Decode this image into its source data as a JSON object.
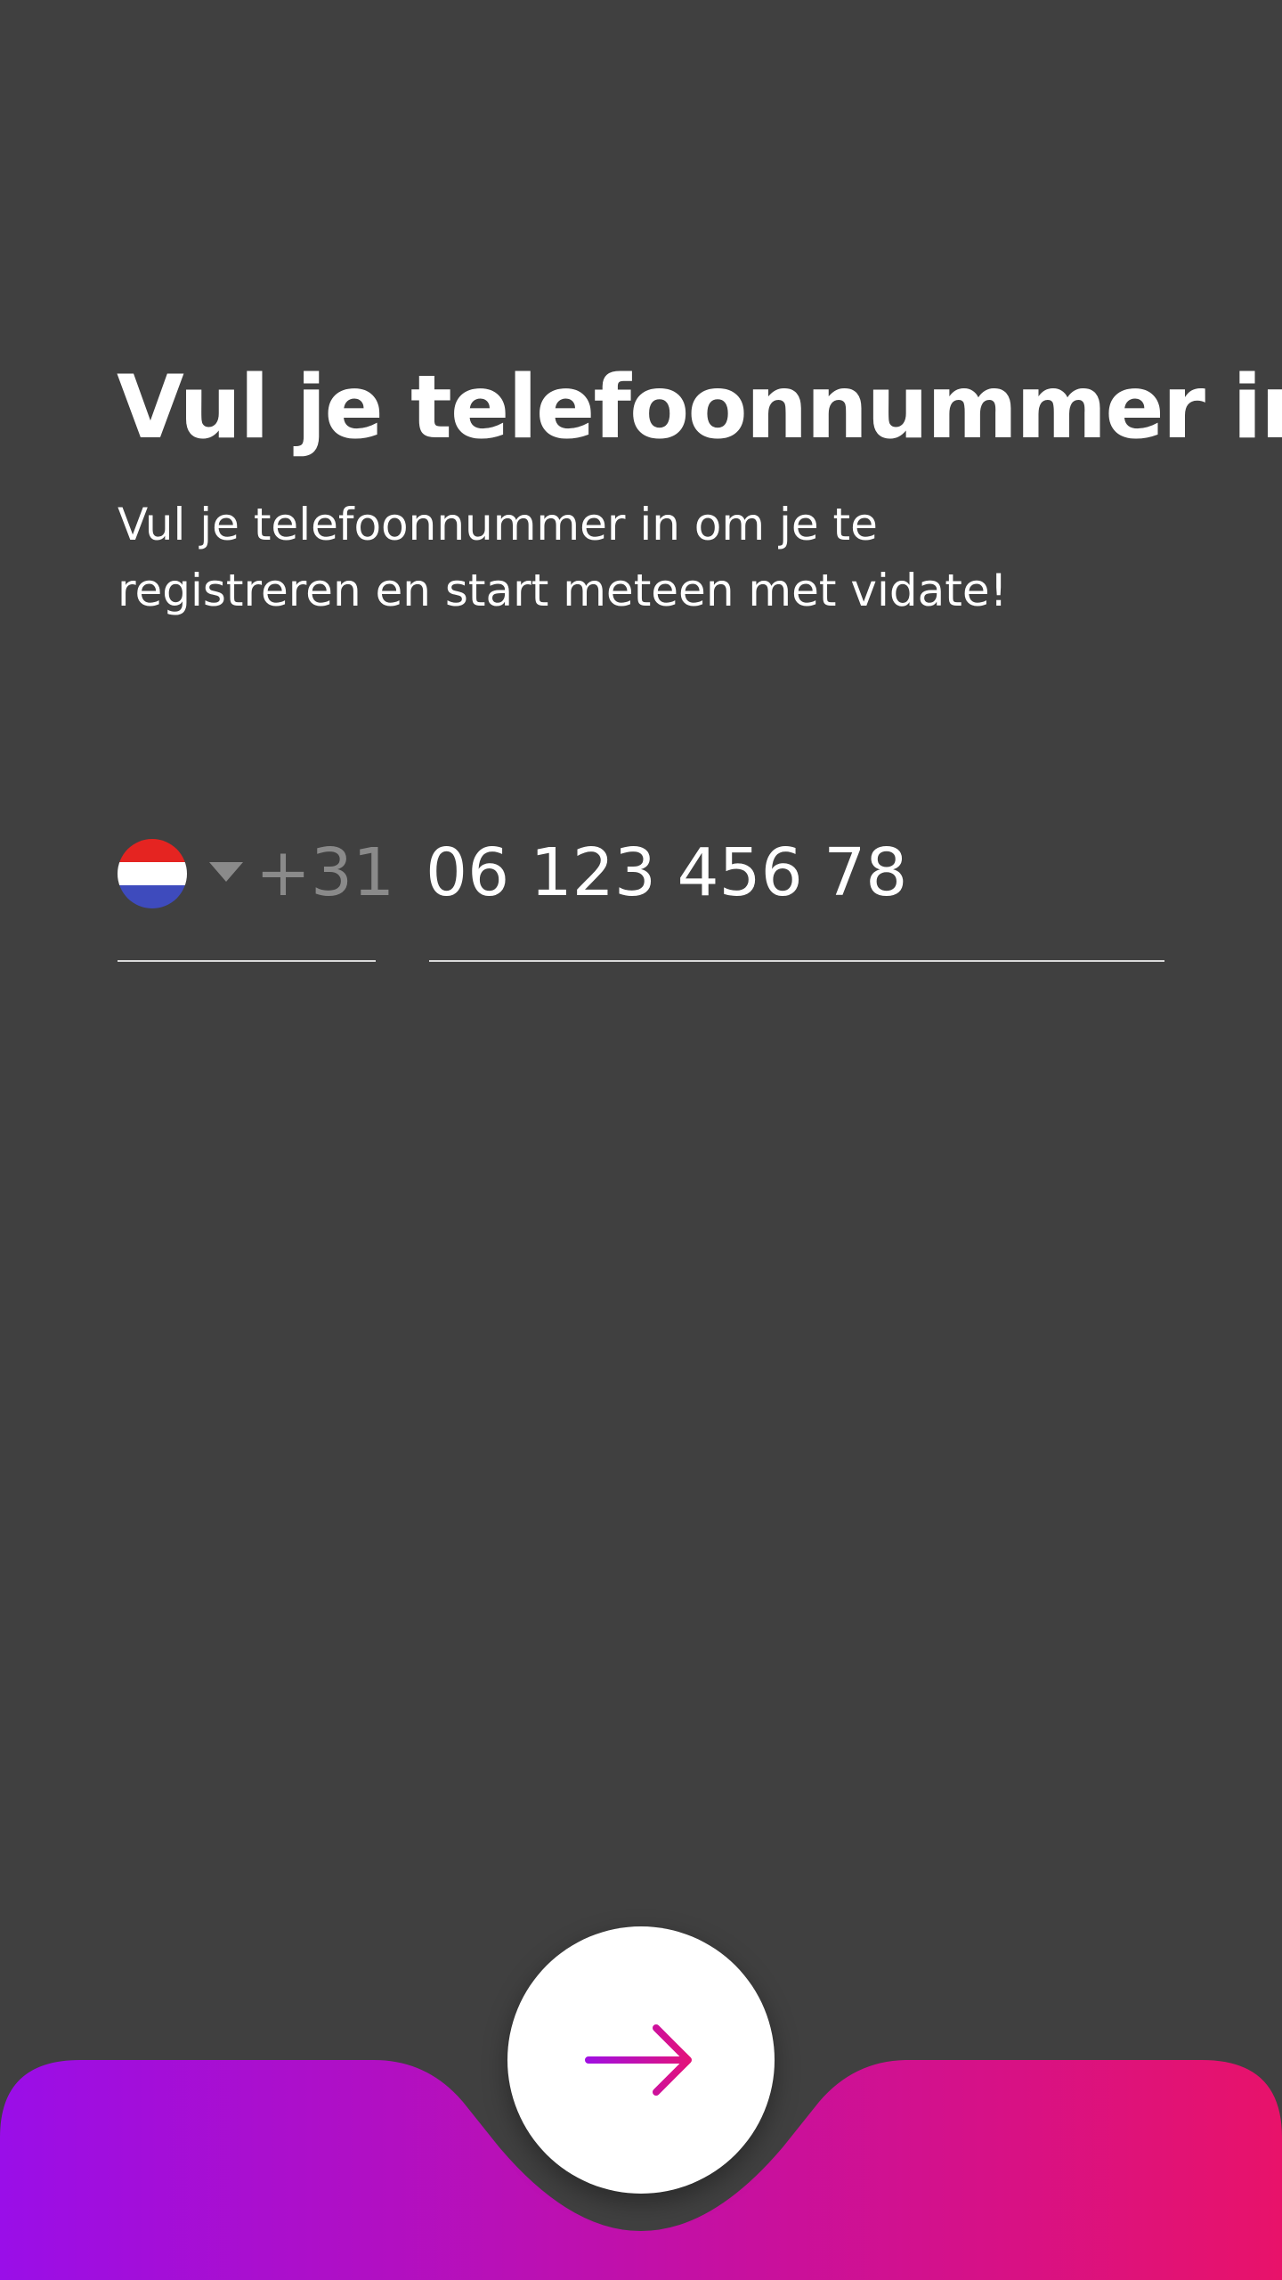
{
  "title": "Vul je telefoonnummer in",
  "subtitle": "Vul je telefoonnummer in om je te registreren en start meteen met vidate!",
  "phone": {
    "country_flag": "netherlands-flag",
    "dial_code": "+31",
    "placeholder": "06 123 456 78",
    "value": ""
  },
  "next_button": {
    "icon": "arrow-right-icon"
  },
  "colors": {
    "background": "#404040",
    "text": "#ffffff",
    "muted": "#8a8a8a",
    "gradient_start": "#9a0ee8",
    "gradient_end": "#e8126a",
    "flag_red": "#e52421",
    "flag_white": "#ffffff",
    "flag_blue": "#3e4bbd"
  }
}
